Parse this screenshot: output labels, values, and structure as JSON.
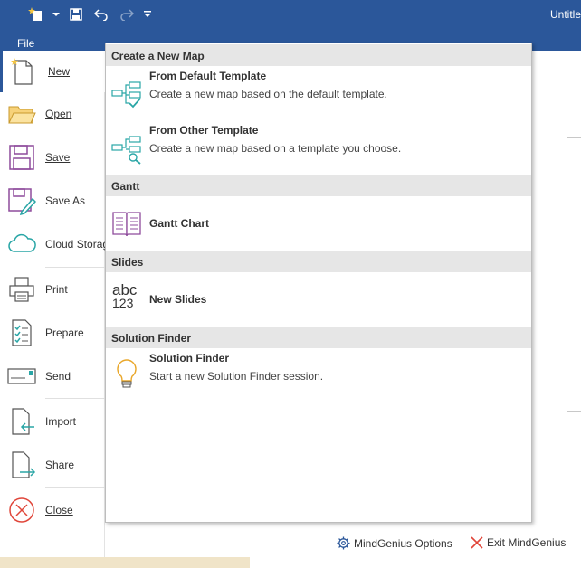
{
  "window": {
    "title": "Untitle"
  },
  "ribbon": {
    "file_tab": "File"
  },
  "backstage": {
    "items": [
      {
        "label": "New",
        "icon": "new-document-icon"
      },
      {
        "label": "Open",
        "icon": "folder-icon"
      },
      {
        "label": "Save",
        "icon": "save-icon"
      },
      {
        "label": "Save As",
        "icon": "save-as-icon"
      },
      {
        "label": "Cloud Storag",
        "icon": "cloud-icon"
      },
      {
        "label": "Print",
        "icon": "printer-icon"
      },
      {
        "label": "Prepare",
        "icon": "checklist-icon"
      },
      {
        "label": "Send",
        "icon": "send-icon"
      },
      {
        "label": "Import",
        "icon": "import-icon"
      },
      {
        "label": "Share",
        "icon": "share-icon"
      },
      {
        "label": "Close",
        "icon": "close-icon"
      }
    ]
  },
  "panel": {
    "sections": [
      {
        "header": "Create a New Map",
        "entries": [
          {
            "title": "From Default Template",
            "desc": "Create a new map based on the default template.",
            "icon": "map-default-template-icon"
          },
          {
            "title": "From Other Template",
            "desc": "Create a new map based on a template you choose.",
            "icon": "map-other-template-icon"
          }
        ]
      },
      {
        "header": "Gantt",
        "entries": [
          {
            "title": "Gantt Chart",
            "icon": "gantt-book-icon"
          }
        ]
      },
      {
        "header": "Slides",
        "entries": [
          {
            "title": "New Slides",
            "icon": "abc-123-icon",
            "icon_text_top": "abc",
            "icon_text_bottom": "123"
          }
        ]
      },
      {
        "header": "Solution Finder",
        "entries": [
          {
            "title": "Solution Finder",
            "desc": "Start a new Solution Finder session.",
            "icon": "lightbulb-icon"
          }
        ]
      }
    ]
  },
  "footer": {
    "options_label": "MindGenius Options",
    "exit_label": "Exit MindGenius"
  },
  "colors": {
    "titlebar": "#2b579a",
    "accent": "#2b579a",
    "exit_x": "#e0463a",
    "template_icon": "#2aa6a6",
    "gantt_icon": "#8e4b9c"
  }
}
